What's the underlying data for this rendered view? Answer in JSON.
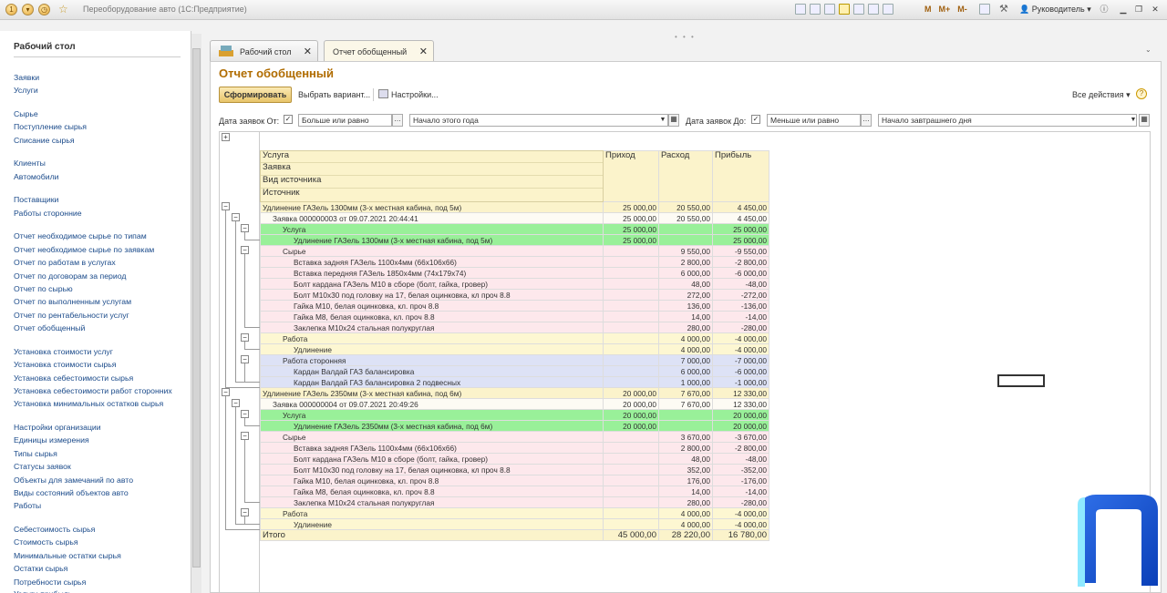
{
  "window": {
    "title": "Переоборудование авто  (1С:Предприятие)",
    "user": "Руководитель",
    "m_buttons": [
      "M",
      "M+",
      "M-"
    ]
  },
  "sidebar": {
    "heading": "Рабочий стол",
    "items": [
      "Заявки",
      "Услуги",
      "Сырье",
      "Поступление сырья",
      "Списание сырья",
      "Клиенты",
      "Автомобили",
      "Поставщики",
      "Работы сторонние",
      "Отчет необходимое сырье по типам",
      "Отчет необходимое сырье по заявкам",
      "Отчет по работам в услугах",
      "Отчет по договорам за период",
      "Отчет по сырью",
      "Отчет по выполненным услугам",
      "Отчет по рентабельности услуг",
      "Отчет обобщенный",
      "Установка стоимости услуг",
      "Установка стоимости сырья",
      "Установка себестоимости сырья",
      "Установка себестоимости работ сторонних",
      "Установка минимальных остатков сырья",
      "Настройки организации",
      "Единицы измерения",
      "Типы сырья",
      "Статусы заявок",
      "Объекты для замечаний по авто",
      "Виды состояний объектов авто",
      "Работы",
      "Себестоимость сырья",
      "Стоимость сырья",
      "Минимальные остатки сырья",
      "Остатки сырья",
      "Потребности сырья",
      "Услуги прибыль"
    ]
  },
  "tabs": [
    {
      "label": "Рабочий стол"
    },
    {
      "label": "Отчет обобщенный"
    }
  ],
  "report": {
    "title": "Отчет обобщенный",
    "generate_label": "Сформировать",
    "choose_variant_label": "Выбрать вариант...",
    "settings_label": "Настройки...",
    "all_actions_label": "Все действия",
    "filter_from": {
      "label": "Дата заявок От:",
      "condition": "Больше или равно",
      "value": "Начало этого года"
    },
    "filter_to": {
      "label": "Дата заявок До:",
      "condition": "Меньше или равно",
      "value": "Начало завтрашнего дня"
    }
  },
  "table": {
    "headers": {
      "group": [
        "Услуга",
        "Заявка",
        "Вид источника",
        "Источник"
      ],
      "income": "Приход",
      "expense": "Расход",
      "profit": "Прибыль"
    },
    "rows": [
      {
        "cls": "r-lvl0",
        "ind": 0,
        "name": "Удлинение ГАЗель 1300мм (3-х местная кабина, под 5м)",
        "inc": "25 000,00",
        "exp": "20 550,00",
        "pr": "4 450,00"
      },
      {
        "cls": "r-lvl1",
        "ind": 1,
        "name": "Заявка 000000003 от 09.07.2021 20:44:41",
        "inc": "25 000,00",
        "exp": "20 550,00",
        "pr": "4 450,00"
      },
      {
        "cls": "r-green",
        "ind": 2,
        "name": "Услуга",
        "inc": "25 000,00",
        "exp": "",
        "pr": "25 000,00"
      },
      {
        "cls": "r-green",
        "ind": 3,
        "name": "Удлинение ГАЗель 1300мм (3-х местная кабина, под 5м)",
        "inc": "25 000,00",
        "exp": "",
        "pr": "25 000,00"
      },
      {
        "cls": "r-pink",
        "ind": 2,
        "name": "Сырье",
        "inc": "",
        "exp": "9 550,00",
        "pr": "-9 550,00"
      },
      {
        "cls": "r-pink",
        "ind": 3,
        "name": "Вставка задняя ГАЗель 1100х4мм (66х106х66)",
        "inc": "",
        "exp": "2 800,00",
        "pr": "-2 800,00"
      },
      {
        "cls": "r-pink",
        "ind": 3,
        "name": "Вставка передняя ГАЗель 1850х4мм (74х179х74)",
        "inc": "",
        "exp": "6 000,00",
        "pr": "-6 000,00"
      },
      {
        "cls": "r-pink",
        "ind": 3,
        "name": "Болт кардана ГАЗель М10 в сборе (болт, гайка, гровер)",
        "inc": "",
        "exp": "48,00",
        "pr": "-48,00"
      },
      {
        "cls": "r-pink",
        "ind": 3,
        "name": "Болт М10х30 под головку на 17, белая оцинковка, кл проч 8.8",
        "inc": "",
        "exp": "272,00",
        "pr": "-272,00"
      },
      {
        "cls": "r-pink",
        "ind": 3,
        "name": "Гайка М10, белая оцинковка, кл. проч 8.8",
        "inc": "",
        "exp": "136,00",
        "pr": "-136,00"
      },
      {
        "cls": "r-pink",
        "ind": 3,
        "name": "Гайка М8, белая оцинковка, кл. проч 8.8",
        "inc": "",
        "exp": "14,00",
        "pr": "-14,00"
      },
      {
        "cls": "r-pink",
        "ind": 3,
        "name": "Заклепка М10х24 стальная полукруглая",
        "inc": "",
        "exp": "280,00",
        "pr": "-280,00"
      },
      {
        "cls": "r-yellow",
        "ind": 2,
        "name": "Работа",
        "inc": "",
        "exp": "4 000,00",
        "pr": "-4 000,00"
      },
      {
        "cls": "r-yellow",
        "ind": 3,
        "name": "Удлинение",
        "inc": "",
        "exp": "4 000,00",
        "pr": "-4 000,00"
      },
      {
        "cls": "r-blue",
        "ind": 2,
        "name": "Работа сторонняя",
        "inc": "",
        "exp": "7 000,00",
        "pr": "-7 000,00"
      },
      {
        "cls": "r-blue",
        "ind": 3,
        "name": "Кардан Валдай ГАЗ балансировка",
        "inc": "",
        "exp": "6 000,00",
        "pr": "-6 000,00"
      },
      {
        "cls": "r-blue",
        "ind": 3,
        "name": "Кардан Валдай ГАЗ балансировка 2 подвесных",
        "inc": "",
        "exp": "1 000,00",
        "pr": "-1 000,00"
      },
      {
        "cls": "r-lvl0",
        "ind": 0,
        "name": "Удлинение ГАЗель 2350мм (3-х местная кабина, под 6м)",
        "inc": "20 000,00",
        "exp": "7 670,00",
        "pr": "12 330,00"
      },
      {
        "cls": "r-lvl1",
        "ind": 1,
        "name": "Заявка 000000004 от 09.07.2021 20:49:26",
        "inc": "20 000,00",
        "exp": "7 670,00",
        "pr": "12 330,00"
      },
      {
        "cls": "r-green",
        "ind": 2,
        "name": "Услуга",
        "inc": "20 000,00",
        "exp": "",
        "pr": "20 000,00"
      },
      {
        "cls": "r-green",
        "ind": 3,
        "name": "Удлинение ГАЗель 2350мм (3-х местная кабина, под 6м)",
        "inc": "20 000,00",
        "exp": "",
        "pr": "20 000,00"
      },
      {
        "cls": "r-pink",
        "ind": 2,
        "name": "Сырье",
        "inc": "",
        "exp": "3 670,00",
        "pr": "-3 670,00"
      },
      {
        "cls": "r-pink",
        "ind": 3,
        "name": "Вставка задняя ГАЗель 1100х4мм (66х106х66)",
        "inc": "",
        "exp": "2 800,00",
        "pr": "-2 800,00"
      },
      {
        "cls": "r-pink",
        "ind": 3,
        "name": "Болт кардана ГАЗель М10 в сборе (болт, гайка, гровер)",
        "inc": "",
        "exp": "48,00",
        "pr": "-48,00"
      },
      {
        "cls": "r-pink",
        "ind": 3,
        "name": "Болт М10х30 под головку на 17, белая оцинковка, кл проч 8.8",
        "inc": "",
        "exp": "352,00",
        "pr": "-352,00"
      },
      {
        "cls": "r-pink",
        "ind": 3,
        "name": "Гайка М10, белая оцинковка, кл. проч 8.8",
        "inc": "",
        "exp": "176,00",
        "pr": "-176,00"
      },
      {
        "cls": "r-pink",
        "ind": 3,
        "name": "Гайка М8, белая оцинковка, кл. проч 8.8",
        "inc": "",
        "exp": "14,00",
        "pr": "-14,00"
      },
      {
        "cls": "r-pink",
        "ind": 3,
        "name": "Заклепка М10х24 стальная полукруглая",
        "inc": "",
        "exp": "280,00",
        "pr": "-280,00"
      },
      {
        "cls": "r-yellow",
        "ind": 2,
        "name": "Работа",
        "inc": "",
        "exp": "4 000,00",
        "pr": "-4 000,00"
      },
      {
        "cls": "r-yellow",
        "ind": 3,
        "name": "Удлинение",
        "inc": "",
        "exp": "4 000,00",
        "pr": "-4 000,00"
      }
    ],
    "total": {
      "label": "Итого",
      "inc": "45 000,00",
      "exp": "28 220,00",
      "pr": "16 780,00"
    }
  }
}
